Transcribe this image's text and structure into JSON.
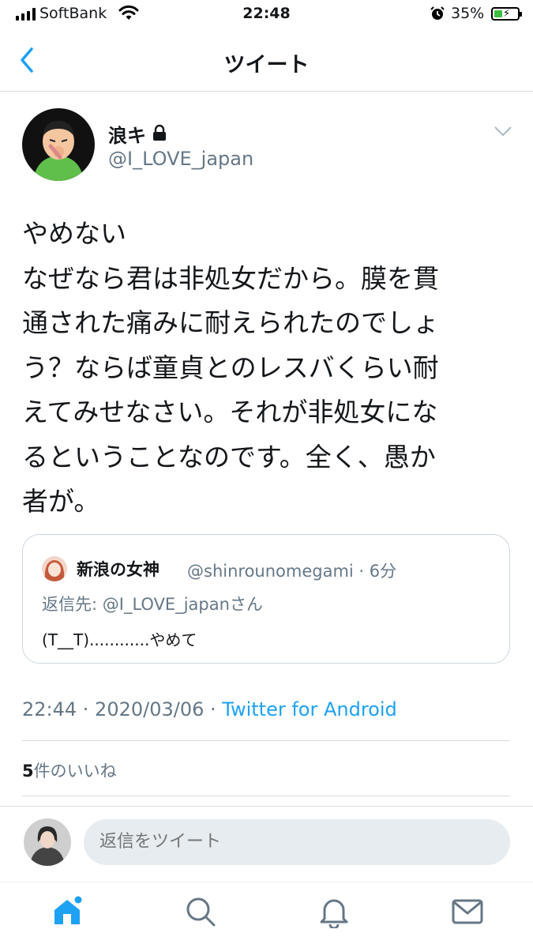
{
  "status_bar": {
    "carrier": "SoftBank",
    "time": "22:48",
    "battery": "35%",
    "battery_level": 0.35
  },
  "nav": {
    "title": "ツイート"
  },
  "tweet": {
    "author_name": "浪キ",
    "author_handle": "@I_LOVE_japan",
    "text": "やめない\nなぜなら君は非処女だから。膜を貫\n通された痛みに耐えられたのでしょ\nう？ならば童貞とのレスバくらい耐\nえてみせなさい。それが非処女にな\nるということなのです。全く、愚か\n者が。",
    "timestamp": "22:44 · 2020/03/06 · ",
    "source": "Twitter for Android",
    "likes_count": "5",
    "likes_label": "件のいいね"
  },
  "quote": {
    "name": "新浪の女神",
    "handle_time": "@shinrounomegami · 6分",
    "reply_prefix": "返信先: ",
    "reply_mention": "@I_LOVE_japan",
    "reply_suffix": "さん",
    "text": "(T__T)............やめて"
  },
  "reply_bar": {
    "placeholder": "返信をツイート"
  },
  "tabs": [
    "home-icon",
    "search-icon",
    "notifications-icon",
    "messages-icon"
  ],
  "colors": {
    "accent": "#1da1f2",
    "secondary_text": "#657786",
    "divider": "#dcdcdc"
  }
}
